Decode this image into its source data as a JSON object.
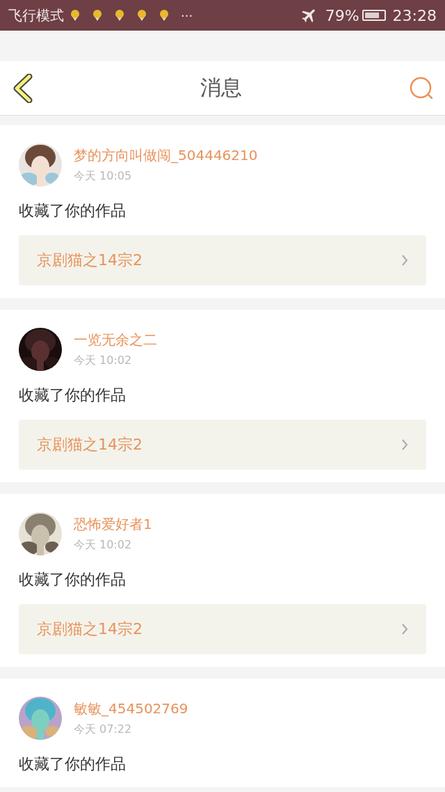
{
  "status_bar": {
    "mode": "飞行模式",
    "more": "···",
    "battery": "79%",
    "time": "23:28"
  },
  "header": {
    "title": "消息"
  },
  "messages": [
    {
      "user": "梦的方向叫做闯_504446210",
      "time": "今天 10:05",
      "text": "收藏了你的作品",
      "work": "京剧猫之14宗2"
    },
    {
      "user": "一览无余之二",
      "time": "今天 10:02",
      "text": "收藏了你的作品",
      "work": "京剧猫之14宗2"
    },
    {
      "user": "恐怖爱好者1",
      "time": "今天 10:02",
      "text": "收藏了你的作品",
      "work": "京剧猫之14宗2"
    },
    {
      "user": "敏敏_454502769",
      "time": "今天 07:22",
      "text": "收藏了你的作品"
    }
  ]
}
